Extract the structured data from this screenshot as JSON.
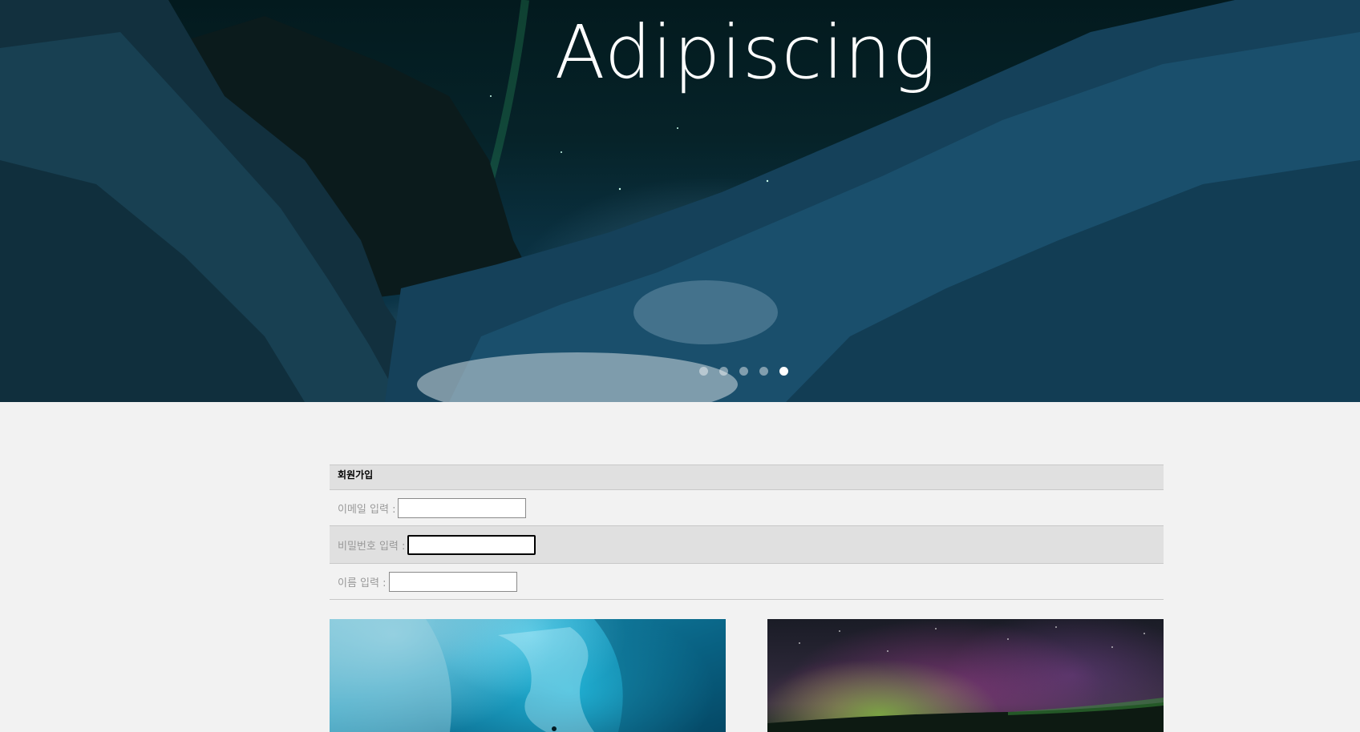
{
  "hero": {
    "title": "Adipiscing",
    "slides_total": 5,
    "active_slide": 5
  },
  "signup_form": {
    "title": "회원가입",
    "fields": [
      {
        "label": "이메일 입력 :",
        "value": ""
      },
      {
        "label": "비밀번호 입력 :",
        "value": ""
      },
      {
        "label": "이름 입력 :",
        "value": ""
      }
    ]
  },
  "colors": {
    "page_background": "#f2f2f2",
    "table_alt_row": "#e0e0e0",
    "label_text": "#999999"
  },
  "gallery": {
    "images": [
      {
        "icon": "ice-cave-photo"
      },
      {
        "icon": "aurora-photo"
      }
    ]
  }
}
